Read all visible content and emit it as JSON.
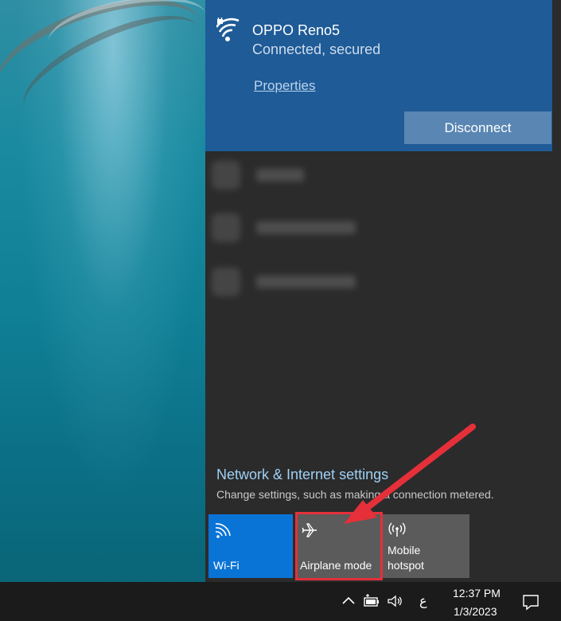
{
  "network": {
    "name": "OPPO Reno5",
    "status": "Connected, secured",
    "properties_label": "Properties",
    "disconnect_label": "Disconnect"
  },
  "settings": {
    "title": "Network & Internet settings",
    "subtitle": "Change settings, such as making a connection metered."
  },
  "quick_actions": [
    {
      "label": "Wi-Fi",
      "icon": "wifi-icon",
      "active": true
    },
    {
      "label": "Airplane mode",
      "icon": "airplane-icon",
      "active": false
    },
    {
      "label_line1": "Mobile",
      "label_line2": "hotspot",
      "icon": "hotspot-icon",
      "active": false
    }
  ],
  "taskbar": {
    "language": "ع",
    "time": "12:37 PM",
    "date": "1/3/2023",
    "icons": [
      "chevron-up-icon",
      "battery-icon",
      "volume-icon",
      "action-center-icon"
    ]
  },
  "colors": {
    "accent": "#0a74d6",
    "connected_card": "#1e5b97",
    "annotation": "#e5303a"
  }
}
